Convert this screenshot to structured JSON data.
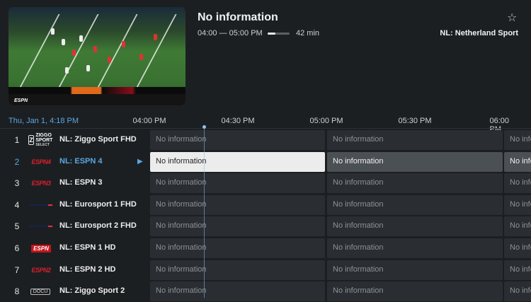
{
  "program": {
    "title": "No information",
    "time_range": "04:00 — 05:00 PM",
    "progress": 0.35,
    "duration": "42 min",
    "channel": "NL: Netherland Sport"
  },
  "timeline": {
    "current": "Thu, Jan 1, 4:18 PM",
    "ticks": [
      "04:00 PM",
      "04:30 PM",
      "05:00 PM",
      "05:30 PM",
      "06:00 PM"
    ]
  },
  "preview": {
    "logo_text": "ESPN"
  },
  "icons": {
    "favorite": "star-outline-icon",
    "selected_marker": "play-triangle-icon"
  },
  "colors": {
    "accent": "#5aa7e6",
    "focus_cell": "#ececec",
    "cell": "#2a2e32"
  },
  "channels": [
    {
      "num": "1",
      "logo": "ziggo-sport-select",
      "logo_mark": "Z",
      "logo_text": "ZIGGO SPORT",
      "logo_sub": "SELECT",
      "name": "NL: Ziggo Sport FHD",
      "cells": [
        "No information",
        "No information",
        "No info"
      ]
    },
    {
      "num": "2",
      "logo": "espn4",
      "logo_text": "ESPN4",
      "name": "NL: ESPN 4",
      "cells": [
        "No information",
        "No information",
        "No info"
      ],
      "selected": true
    },
    {
      "num": "3",
      "logo": "espn3",
      "logo_text": "ESPN3",
      "name": "NL: ESPN 3",
      "cells": [
        "No information",
        "No information",
        "No info"
      ]
    },
    {
      "num": "4",
      "logo": "eurosport1",
      "name": "NL: Eurosport 1 FHD",
      "cells": [
        "No information",
        "No information",
        "No info"
      ]
    },
    {
      "num": "5",
      "logo": "eurosport2",
      "name": "NL: Eurosport 2 FHD",
      "cells": [
        "No information",
        "No information",
        "No info"
      ]
    },
    {
      "num": "6",
      "logo": "espn1",
      "logo_text": "ESPN",
      "name": "NL: ESPN 1 HD",
      "cells": [
        "No information",
        "No information",
        "No info"
      ]
    },
    {
      "num": "7",
      "logo": "espn2",
      "logo_text": "ESPN2",
      "name": "NL: ESPN 2 HD",
      "cells": [
        "No information",
        "No information",
        "No info"
      ]
    },
    {
      "num": "8",
      "logo": "ziggo-sport-2",
      "logo_text": "DOCU",
      "name": "NL: Ziggo Sport 2",
      "cells": [
        "No information",
        "No information",
        "No info"
      ]
    }
  ]
}
